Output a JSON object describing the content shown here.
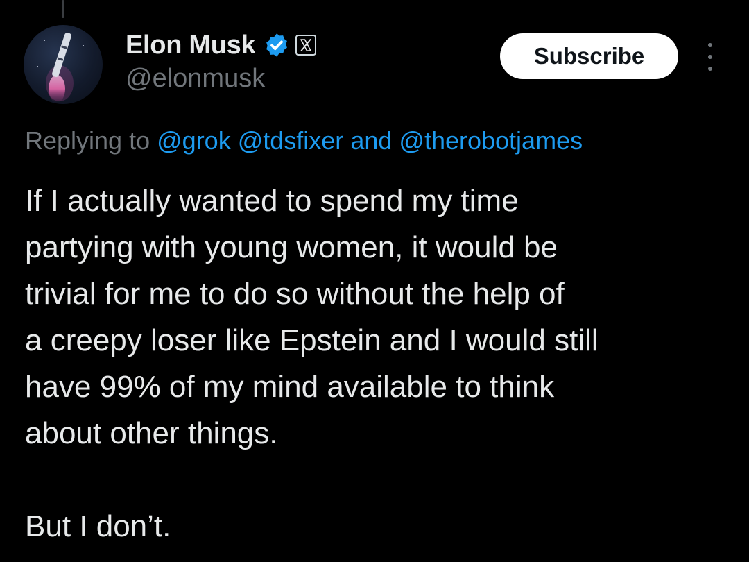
{
  "author": {
    "name": "Elon Musk",
    "handle": "@elonmusk",
    "verified": true,
    "affiliate_badge": "X"
  },
  "actions": {
    "subscribe_label": "Subscribe",
    "more_icon": "more-vertical-icon"
  },
  "reply_context": {
    "prefix": "Replying to",
    "mentions": [
      "@grok",
      "@tdsfixer",
      "@therobotjames"
    ],
    "conjunction": "and"
  },
  "tweet": {
    "lines": [
      "If I actually wanted to spend my time",
      "partying with young women, it would be",
      "trivial for me to do so without the help of",
      "a creepy loser like Epstein and I would still",
      "have 99% of my mind available to think",
      "about other things."
    ],
    "closing": "But I don’t."
  },
  "colors": {
    "background": "#000000",
    "text": "#e7e9ea",
    "secondary_text": "#71767b",
    "link": "#1d9bf0",
    "verified": "#1d9bf0",
    "button_bg": "#ffffff",
    "button_text": "#0f1419"
  }
}
